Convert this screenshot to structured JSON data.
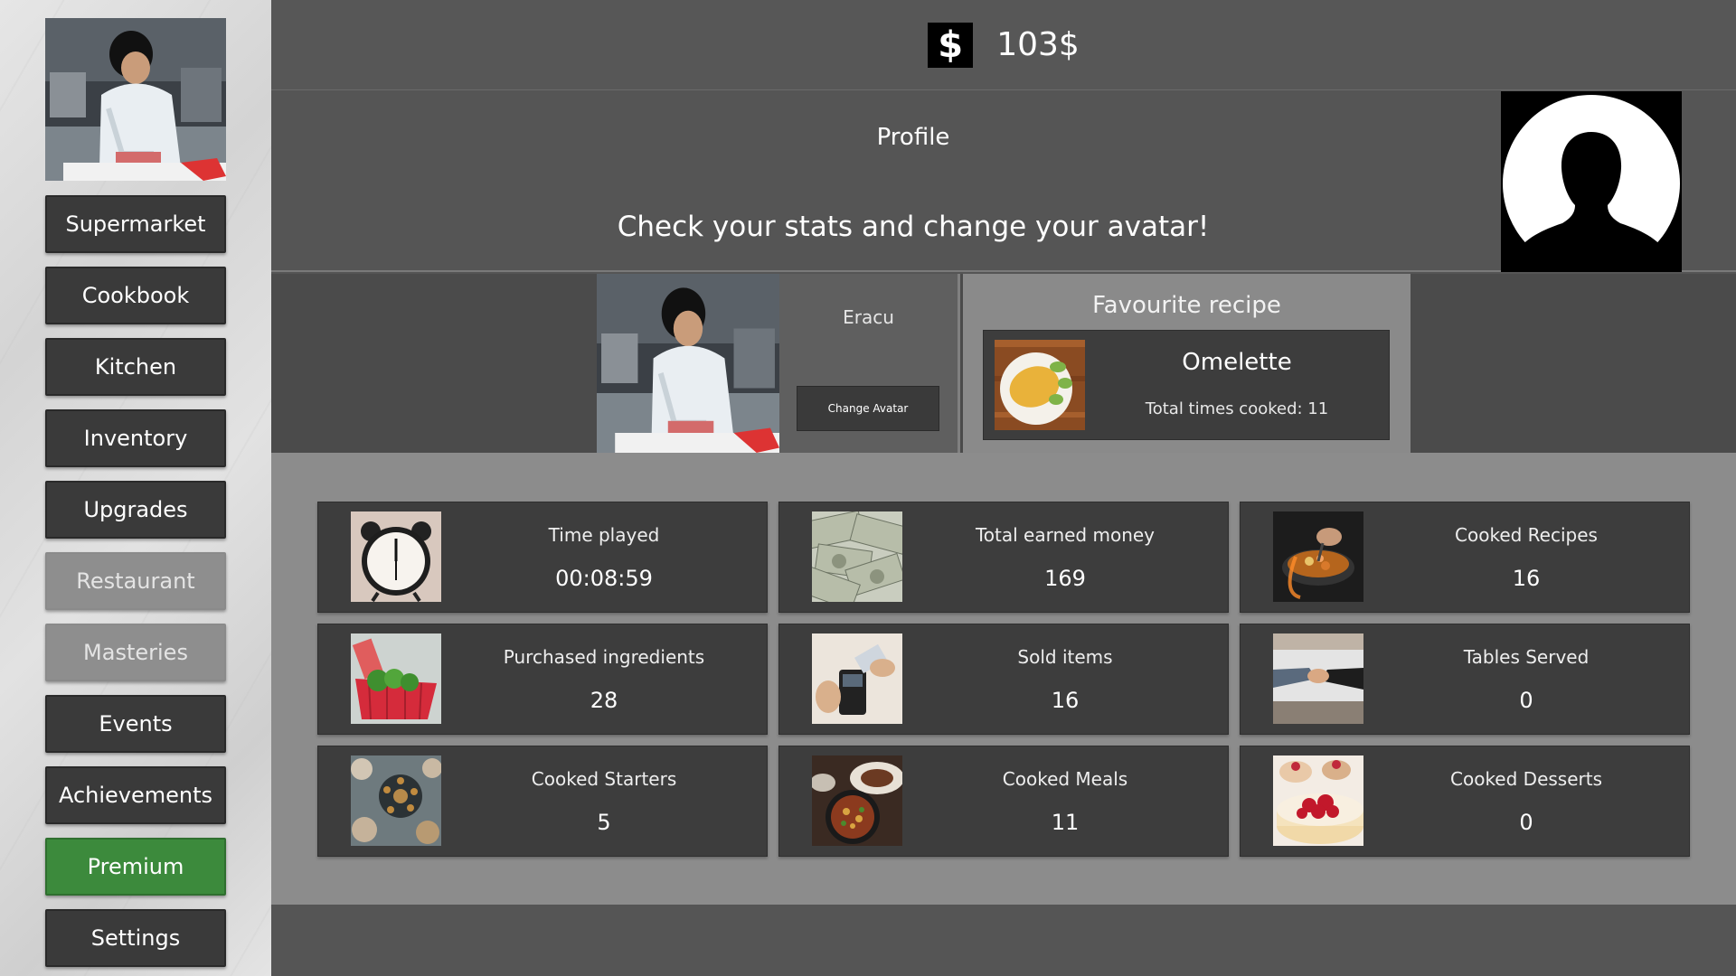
{
  "currency": {
    "icon": "dollar-icon",
    "symbol": "$",
    "amount": "103$"
  },
  "sidebar": {
    "items": [
      {
        "label": "Supermarket",
        "state": "enabled"
      },
      {
        "label": "Cookbook",
        "state": "enabled"
      },
      {
        "label": "Kitchen",
        "state": "enabled"
      },
      {
        "label": "Inventory",
        "state": "enabled"
      },
      {
        "label": "Upgrades",
        "state": "enabled"
      },
      {
        "label": "Restaurant",
        "state": "disabled"
      },
      {
        "label": "Masteries",
        "state": "disabled"
      },
      {
        "label": "Events",
        "state": "enabled"
      },
      {
        "label": "Achievements",
        "state": "enabled"
      },
      {
        "label": "Premium",
        "state": "highlight"
      },
      {
        "label": "Settings",
        "state": "enabled"
      }
    ]
  },
  "profile": {
    "title": "Profile",
    "subtitle": "Check your stats and change your avatar!",
    "player_name": "Eracu",
    "change_avatar_label": "Change Avatar"
  },
  "favourite": {
    "title": "Favourite recipe",
    "recipe": "Omelette",
    "times_cooked": "Total times cooked: 11"
  },
  "stats": [
    {
      "label": "Time played",
      "value": "00:08:59",
      "icon": "alarm-clock-icon"
    },
    {
      "label": "Total earned money",
      "value": "169",
      "icon": "money-bills-icon"
    },
    {
      "label": "Cooked Recipes",
      "value": "16",
      "icon": "frying-pan-icon"
    },
    {
      "label": "Purchased ingredients",
      "value": "28",
      "icon": "shopping-basket-icon"
    },
    {
      "label": "Sold items",
      "value": "16",
      "icon": "card-payment-icon"
    },
    {
      "label": "Tables Served",
      "value": "0",
      "icon": "handshake-icon"
    },
    {
      "label": "Cooked Starters",
      "value": "5",
      "icon": "starter-plates-icon"
    },
    {
      "label": "Cooked Meals",
      "value": "11",
      "icon": "meal-plates-icon"
    },
    {
      "label": "Cooked Desserts",
      "value": "0",
      "icon": "cake-icon"
    }
  ],
  "colors": {
    "panel": "#3d3d3d",
    "background": "#555555",
    "premium": "#3c8a3c",
    "disabled": "#8e8e8e"
  }
}
